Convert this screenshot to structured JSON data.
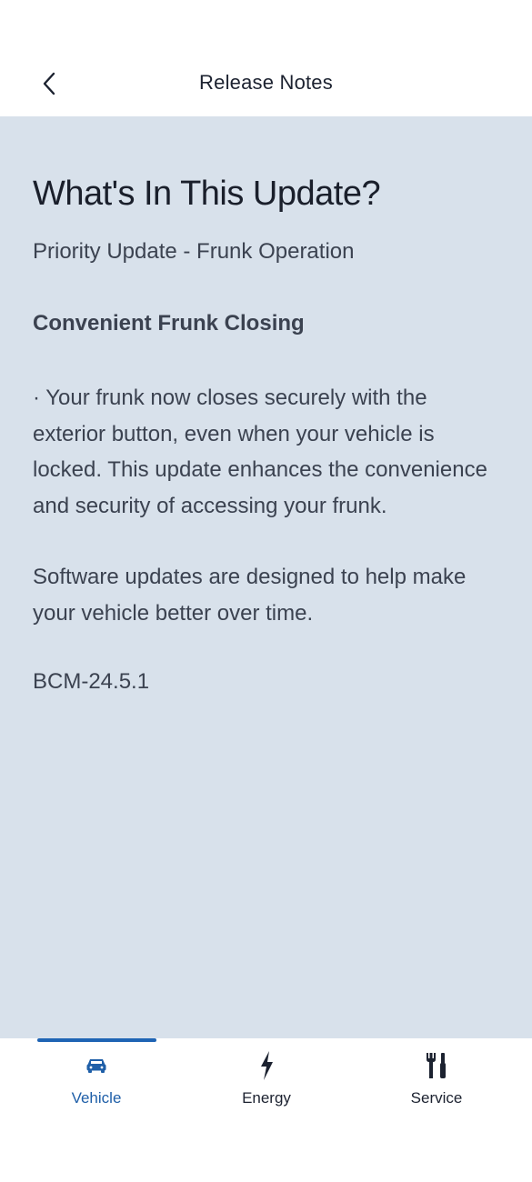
{
  "header": {
    "title": "Release Notes",
    "back_icon": "chevron-left-icon"
  },
  "content": {
    "heading": "What's In This Update?",
    "subtitle": "Priority Update - Frunk Operation",
    "section_heading": "Convenient Frunk Closing",
    "paragraph_1": "· Your frunk now closes securely with the exterior button, even when your vehicle is locked. This update enhances the convenience and security of accessing your frunk.",
    "paragraph_2": "Software updates are designed to help make your vehicle better over time.",
    "version": "BCM-24.5.1"
  },
  "bottom_nav": {
    "items": [
      {
        "label": "Vehicle",
        "icon": "car-icon",
        "active": true
      },
      {
        "label": "Energy",
        "icon": "lightning-icon",
        "active": false
      },
      {
        "label": "Service",
        "icon": "tools-icon",
        "active": false
      }
    ]
  },
  "colors": {
    "content_background": "#d8e1eb",
    "accent": "#1f64b4",
    "text_primary": "#1a1f2b",
    "text_secondary": "#3b4250"
  }
}
